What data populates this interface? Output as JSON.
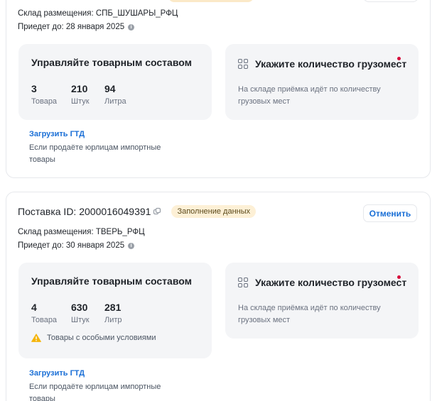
{
  "supplies": [
    {
      "title": "",
      "status": "",
      "cancel_label": "",
      "warehouse": "Склад размещения: СПБ_ШУШАРЫ_РФЦ",
      "arrive": "Приедет до: 28 января 2025",
      "goods_panel": {
        "title": "Управляйте товарным составом",
        "stats": [
          {
            "value": "3",
            "label": "Товара"
          },
          {
            "value": "210",
            "label": "Штук"
          },
          {
            "value": "94",
            "label": "Литра"
          }
        ],
        "warning": ""
      },
      "cargo_panel": {
        "title": "Укажите количество грузомест",
        "desc": "На складе приёмка идёт по количеству грузовых мест"
      },
      "gtd_link": "Загрузить ГТД",
      "gtd_hint": "Если продаёте юрлицам импортные товары"
    },
    {
      "title": "Поставка ID: 2000016049391",
      "status": "Заполнение данных",
      "cancel_label": "Отменить",
      "warehouse": "Склад размещения: ТВЕРЬ_РФЦ",
      "arrive": "Приедет до: 30 января 2025",
      "goods_panel": {
        "title": "Управляйте товарным составом",
        "stats": [
          {
            "value": "4",
            "label": "Товара"
          },
          {
            "value": "630",
            "label": "Штук"
          },
          {
            "value": "281",
            "label": "Литр"
          }
        ],
        "warning": "Товары с особыми условиями"
      },
      "cargo_panel": {
        "title": "Укажите количество грузомест",
        "desc": "На складе приёмка идёт по количеству грузовых мест"
      },
      "gtd_link": "Загрузить ГТД",
      "gtd_hint": "Если продаёте юрлицам импортные товары"
    }
  ],
  "colors": {
    "accent": "#1a6fd6",
    "status_bg": "#fdf0d6",
    "panel_bg": "#f4f5f7",
    "alert_dot": "#d70f3c",
    "warning": "#f5b50a"
  },
  "icons": [
    "info-icon",
    "link-icon",
    "grid-icon",
    "warning-icon"
  ]
}
